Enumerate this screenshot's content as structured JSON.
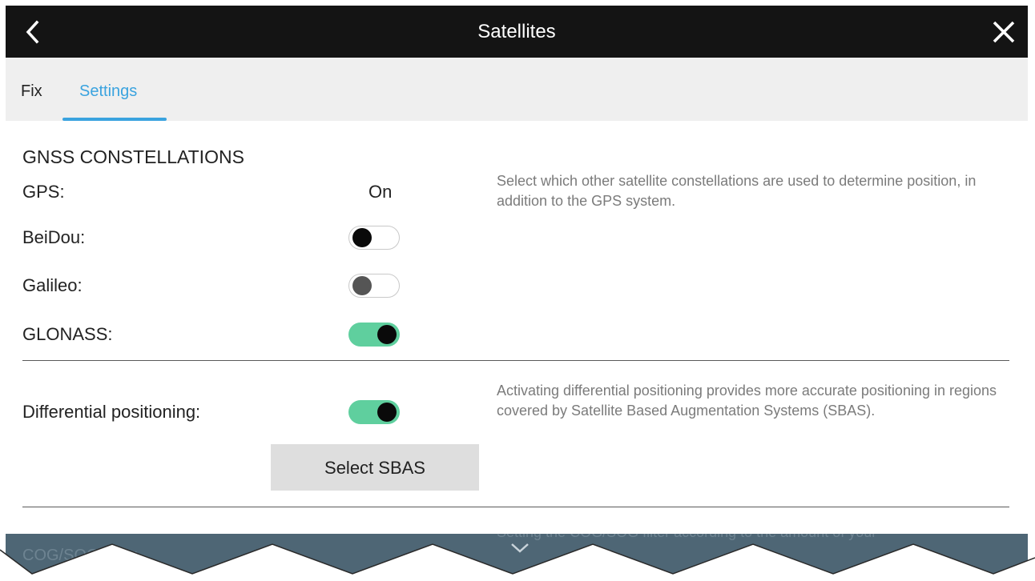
{
  "titlebar": {
    "title": "Satellites",
    "back_icon": "chevron-left-icon",
    "close_icon": "close-icon"
  },
  "tabs": [
    {
      "label": "Fix",
      "active": false
    },
    {
      "label": "Settings",
      "active": true
    }
  ],
  "gnss": {
    "heading": "GNSS CONSTELLATIONS",
    "description": "Select which other satellite constellations are used to determine position, in addition to the GPS system.",
    "gps": {
      "label": "GPS:",
      "value": "On"
    },
    "beidou": {
      "label": "BeiDou:",
      "enabled": false
    },
    "galileo": {
      "label": "Galileo:",
      "enabled": false
    },
    "glonass": {
      "label": "GLONASS:",
      "enabled": true
    }
  },
  "differential": {
    "label": "Differential positioning:",
    "enabled": true,
    "description": "Activating differential positioning provides more accurate positioning in regions covered by Satellite Based Augmentation Systems (SBAS).",
    "button_label": "Select SBAS"
  },
  "bottom": {
    "partial_label": "COG/SOG filter:",
    "partial_description": "Setting the COG/SOG filter according to the amount of your",
    "scroll_icon": "chevron-down-icon"
  },
  "colors": {
    "accent": "#3aa3df",
    "toggle_on": "#5fcf9e",
    "titlebar": "#141414",
    "overlay": "#4e6675"
  }
}
